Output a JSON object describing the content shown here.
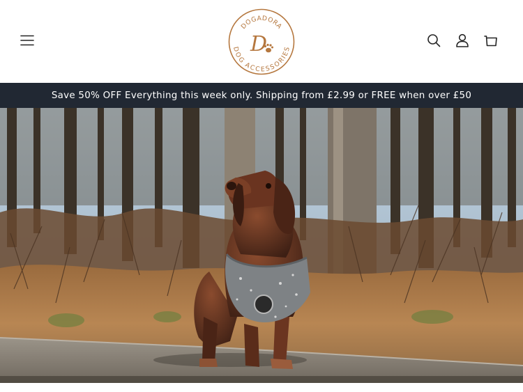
{
  "logo": {
    "brand_text": "DOGADORA",
    "tagline_text": "DOG ACCESSORIES",
    "monogram": "D",
    "color": "#b5773e"
  },
  "header": {
    "icons": [
      "menu-icon",
      "search-icon",
      "account-icon",
      "cart-icon"
    ]
  },
  "announcement": {
    "text": "Save 50% OFF Everything this week only. Shipping from £2.99 or FREE when over £50",
    "background": "#212833",
    "color": "#ffffff"
  },
  "hero": {
    "image": "Brown dachshund wearing a grey star-patterned harness standing on a log in a forest"
  }
}
